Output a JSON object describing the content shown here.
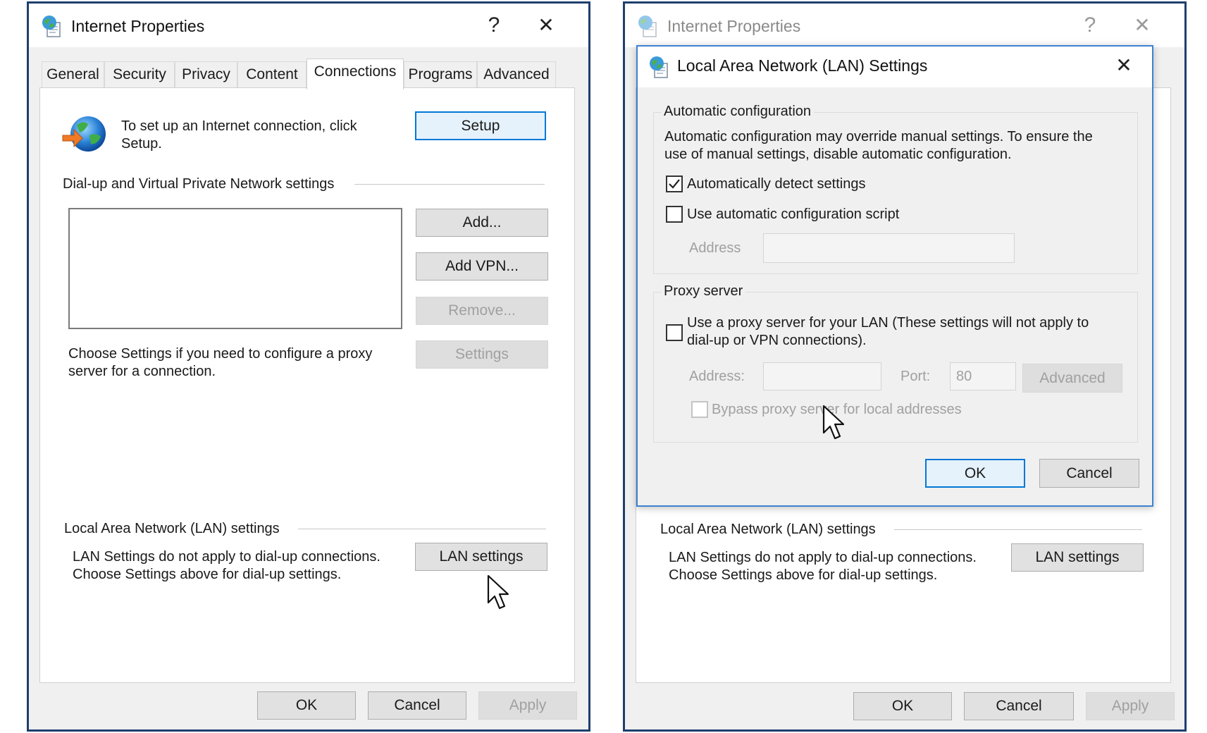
{
  "left_window": {
    "title": "Internet Properties",
    "help_glyph": "?",
    "close_glyph": "✕",
    "tabs": [
      "General",
      "Security",
      "Privacy",
      "Content",
      "Connections",
      "Programs",
      "Advanced"
    ],
    "active_tab": "Connections",
    "setup_text": "To set up an Internet connection, click Setup.",
    "setup_text_line1": "To set up an Internet connection, click",
    "setup_text_line2": "Setup.",
    "setup_button": "Setup",
    "dialup_group_label": "Dial-up and Virtual Private Network settings",
    "add_button": "Add...",
    "add_vpn_button": "Add VPN...",
    "remove_button": "Remove...",
    "settings_button": "Settings",
    "proxy_text_line1": "Choose Settings if you need to configure a proxy",
    "proxy_text_line2": "server for a connection.",
    "lan_group_label": "Local Area Network (LAN) settings",
    "lan_text_line1": "LAN Settings do not apply to dial-up connections.",
    "lan_text_line2": "Choose Settings above for dial-up settings.",
    "lan_settings_button": "LAN settings",
    "ok_button": "OK",
    "cancel_button": "Cancel",
    "apply_button": "Apply"
  },
  "right_window": {
    "title": "Internet Properties",
    "help_glyph": "?",
    "close_glyph": "✕",
    "lan_group_label": "Local Area Network (LAN) settings",
    "lan_text_line1": "LAN Settings do not apply to dial-up connections.",
    "lan_text_line2": "Choose Settings above for dial-up settings.",
    "lan_settings_button": "LAN settings",
    "ok_button": "OK",
    "cancel_button": "Cancel",
    "apply_button": "Apply"
  },
  "lan_dialog": {
    "title": "Local Area Network (LAN) Settings",
    "close_glyph": "✕",
    "auto_config_label": "Automatic configuration",
    "auto_config_desc_line1": "Automatic configuration may override manual settings.  To ensure the",
    "auto_config_desc_line2": "use of manual settings, disable automatic configuration.",
    "auto_detect_label": "Automatically detect settings",
    "auto_detect_checked": true,
    "auto_script_label": "Use automatic configuration script",
    "auto_script_checked": false,
    "script_address_label": "Address",
    "script_address_value": "",
    "proxy_group_label": "Proxy server",
    "proxy_use_line1": "Use a proxy server for your LAN (These settings will not apply to",
    "proxy_use_line2": "dial-up or VPN connections).",
    "proxy_use_checked": false,
    "proxy_address_label": "Address:",
    "proxy_address_value": "",
    "port_label": "Port:",
    "port_value": "80",
    "advanced_button": "Advanced",
    "bypass_label": "Bypass proxy server for local addresses",
    "bypass_checked": false,
    "ok_button": "OK",
    "cancel_button": "Cancel"
  },
  "colors": {
    "accent_blue": "#0078d7",
    "window_frame": "#1f3f6e",
    "dialog_border": "#3c82d0",
    "disabled_text": "#a0a0a0"
  },
  "icons": {
    "title_icon": "internet-properties-icon",
    "globe": "globe-connection-icon",
    "cursor": "mouse-pointer-icon",
    "checkmark": "checkmark-icon"
  }
}
